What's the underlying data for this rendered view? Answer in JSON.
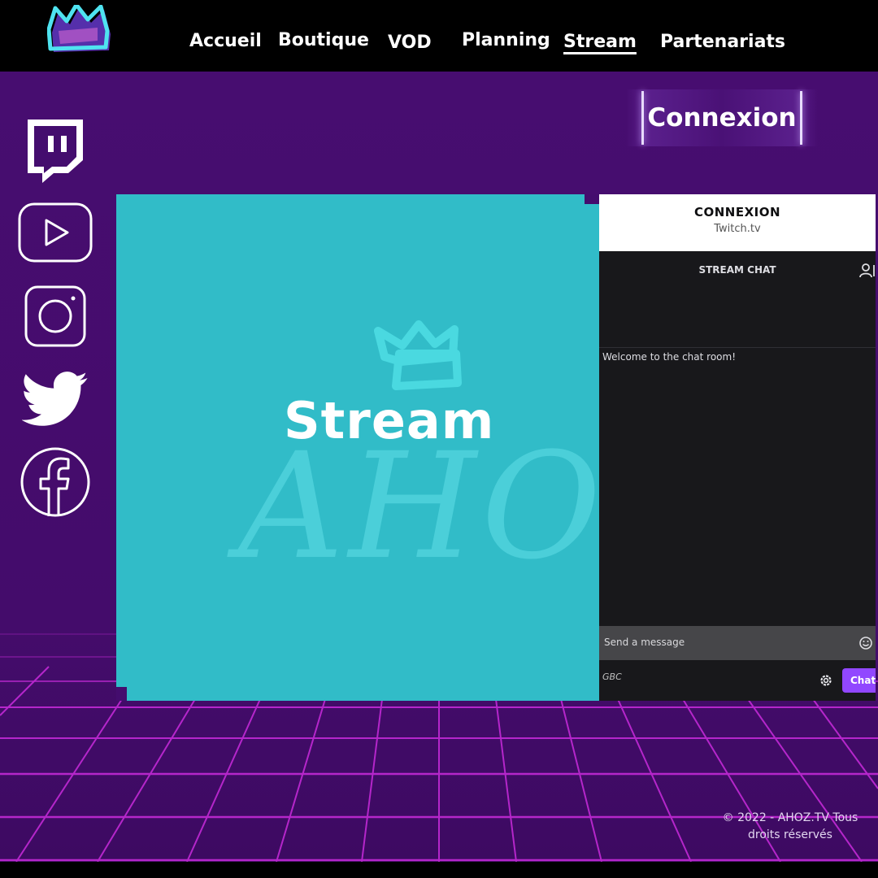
{
  "header": {
    "logo_icon": "crown-icon",
    "nav": [
      {
        "label": "Accueil",
        "active": false
      },
      {
        "label": "Boutique",
        "active": false
      },
      {
        "label": "VOD",
        "active": false
      },
      {
        "label": "Planning",
        "active": false
      },
      {
        "label": "Stream",
        "active": true
      },
      {
        "label": "Partenariats",
        "active": false
      }
    ]
  },
  "auth": {
    "connexion_label": "Connexion"
  },
  "socials": [
    {
      "icon": "twitch-icon"
    },
    {
      "icon": "youtube-icon"
    },
    {
      "icon": "instagram-icon"
    },
    {
      "icon": "twitter-icon"
    },
    {
      "icon": "facebook-icon"
    }
  ],
  "stream": {
    "title": "Stream",
    "thumbnail_text": "AHOZ"
  },
  "chat": {
    "connect_title": "CONNEXION",
    "connect_subtitle": "Twitch.tv",
    "title": "STREAM CHAT",
    "welcome": "Welcome to the chat room!",
    "placeholder": "Send a message",
    "badge_alt": "GBC",
    "chat_button": "Chat"
  },
  "footer": {
    "copyright_line1": "© 2022 - AHOZ.TV Tous",
    "copyright_line2": "droits réservés"
  },
  "colors": {
    "background": "#440d6e",
    "stream_panel": "#31bcc8",
    "chat_button": "#9147ff",
    "grid_line": "#c22ad6"
  }
}
